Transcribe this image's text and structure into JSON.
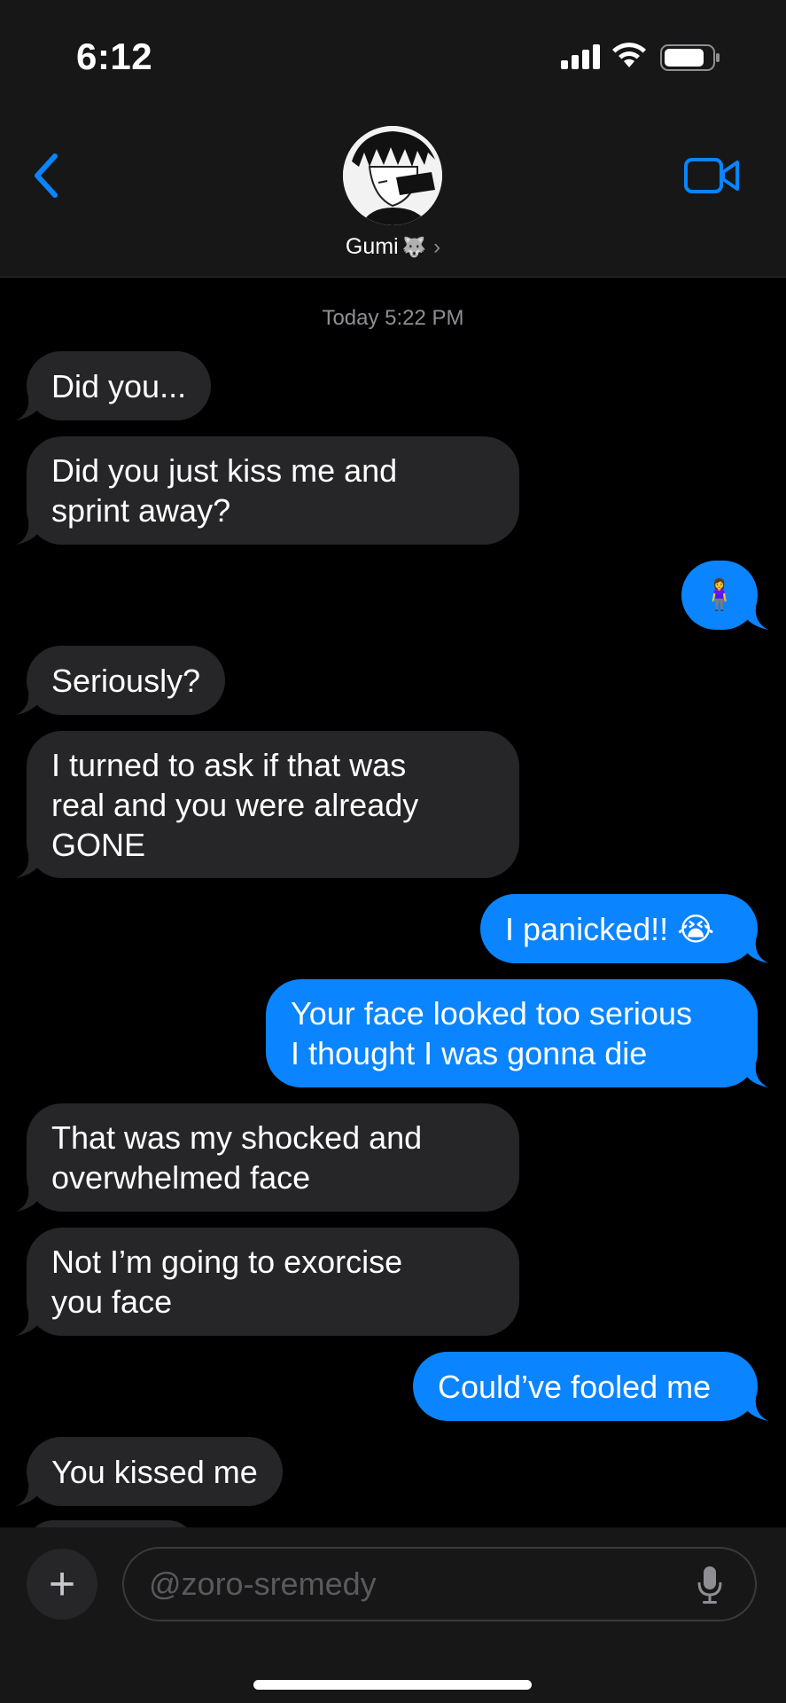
{
  "status_bar": {
    "time": "6:12"
  },
  "header": {
    "contact_name": "Gumi",
    "contact_emoji": "🐺",
    "chevron": "›"
  },
  "thread": {
    "timestamp_day": "Today",
    "timestamp_time": "5:22 PM",
    "messages": [
      {
        "from": "them",
        "text": "Did you..."
      },
      {
        "from": "them",
        "text": "Did you just kiss me and\nsprint away?"
      },
      {
        "from": "me",
        "text": "🧍‍♀️"
      },
      {
        "from": "them",
        "text": "Seriously?"
      },
      {
        "from": "them",
        "text": "I turned to ask if that was\nreal and you were already\nGONE"
      },
      {
        "from": "me",
        "text": "I panicked!! 😭"
      },
      {
        "from": "me",
        "text": "Your face looked too serious\nI thought I was gonna die"
      },
      {
        "from": "them",
        "text": "That was my shocked and\noverwhelmed face"
      },
      {
        "from": "them",
        "text": "Not I’m going to exorcise\nyou face"
      },
      {
        "from": "me",
        "text": "Could’ve fooled me"
      },
      {
        "from": "them",
        "text": "You kissed me"
      }
    ]
  },
  "composer": {
    "plus_label": "+",
    "placeholder": "@zoro-sremedy"
  },
  "colors": {
    "incoming_bubble": "#262628",
    "outgoing_bubble": "#0a84ff",
    "accent": "#0a84ff",
    "background": "#000000",
    "header_bg": "#171717"
  }
}
